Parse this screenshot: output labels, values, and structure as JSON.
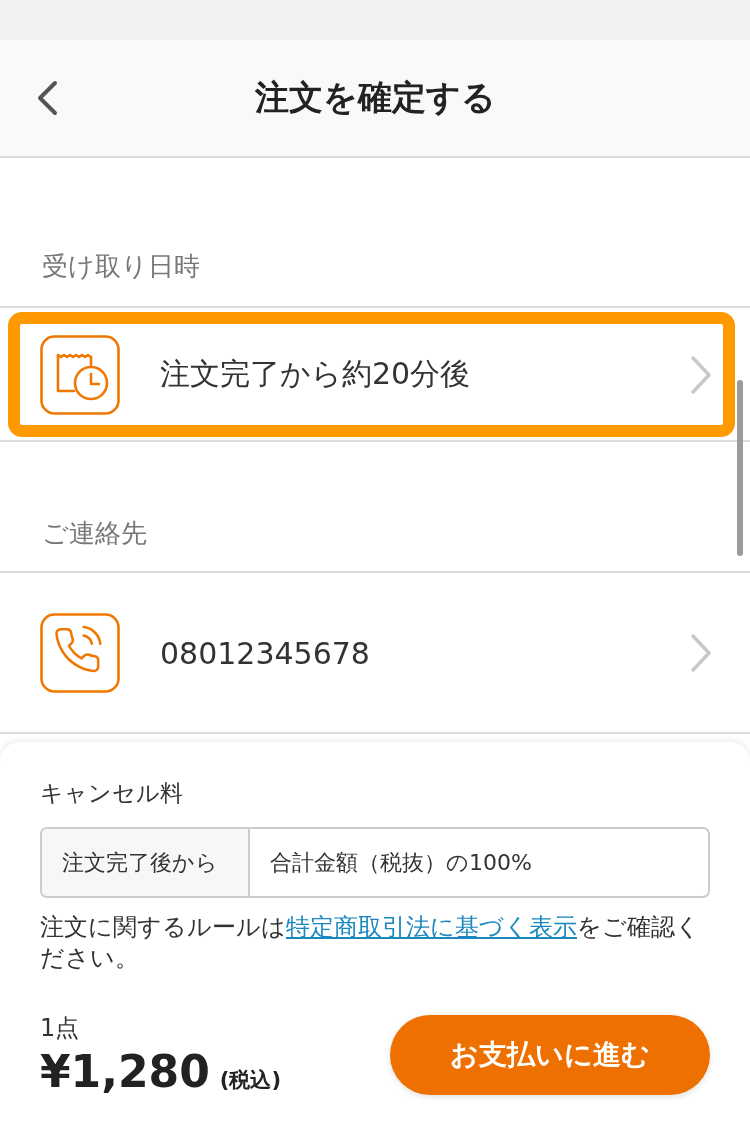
{
  "header": {
    "title": "注文を確定する"
  },
  "sections": [
    {
      "label": "受け取り日時",
      "rows": [
        {
          "kind": "schedule",
          "text": "注文完了から約20分後",
          "highlighted": true
        }
      ]
    },
    {
      "label": "ご連絡先",
      "rows": [
        {
          "kind": "phone",
          "text": "08012345678",
          "highlighted": false
        }
      ]
    }
  ],
  "cancellation": {
    "title": "キャンセル料",
    "rows": [
      {
        "condition": "注文完了後から",
        "fee": "合計金額（税抜）の100%"
      }
    ]
  },
  "notice": {
    "before": "注文に関するルールは",
    "link": "特定商取引法に基づく表示",
    "after": "をご確認ください。"
  },
  "summary": {
    "count": "1点",
    "price": "¥1,280",
    "tax_note": "(税込)"
  },
  "pay_button": {
    "label": "お支払いに進む"
  }
}
